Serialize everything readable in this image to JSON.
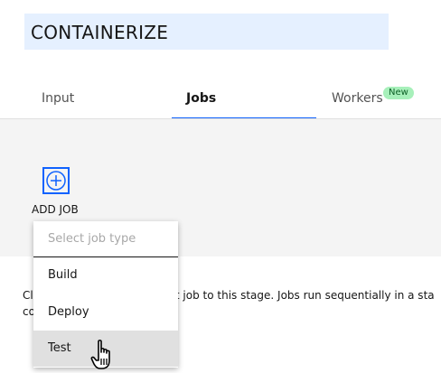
{
  "header": {
    "title": "CONTAINERIZE"
  },
  "tabs": [
    {
      "label": "Input"
    },
    {
      "label": "Jobs",
      "active": true
    },
    {
      "label": "Workers",
      "badge": "New"
    }
  ],
  "stage": {
    "add_job_label": "ADD JOB",
    "description_line1": "Cl",
    "description_line1_rest": "rst job to this stage. Jobs run sequentially in a sta",
    "description_line2": "co"
  },
  "job_type_dropdown": {
    "placeholder": "Select job type",
    "options": [
      "Build",
      "Deploy",
      "Test"
    ],
    "highlighted": "Test"
  },
  "colors": {
    "accent": "#0f62fe",
    "title_bg": "#e5f0ff",
    "badge_bg": "#a7f0ba",
    "band_bg": "#f4f4f4"
  },
  "icons": {
    "add": "plus-circle-icon",
    "pointer": "hand-pointer-icon"
  }
}
